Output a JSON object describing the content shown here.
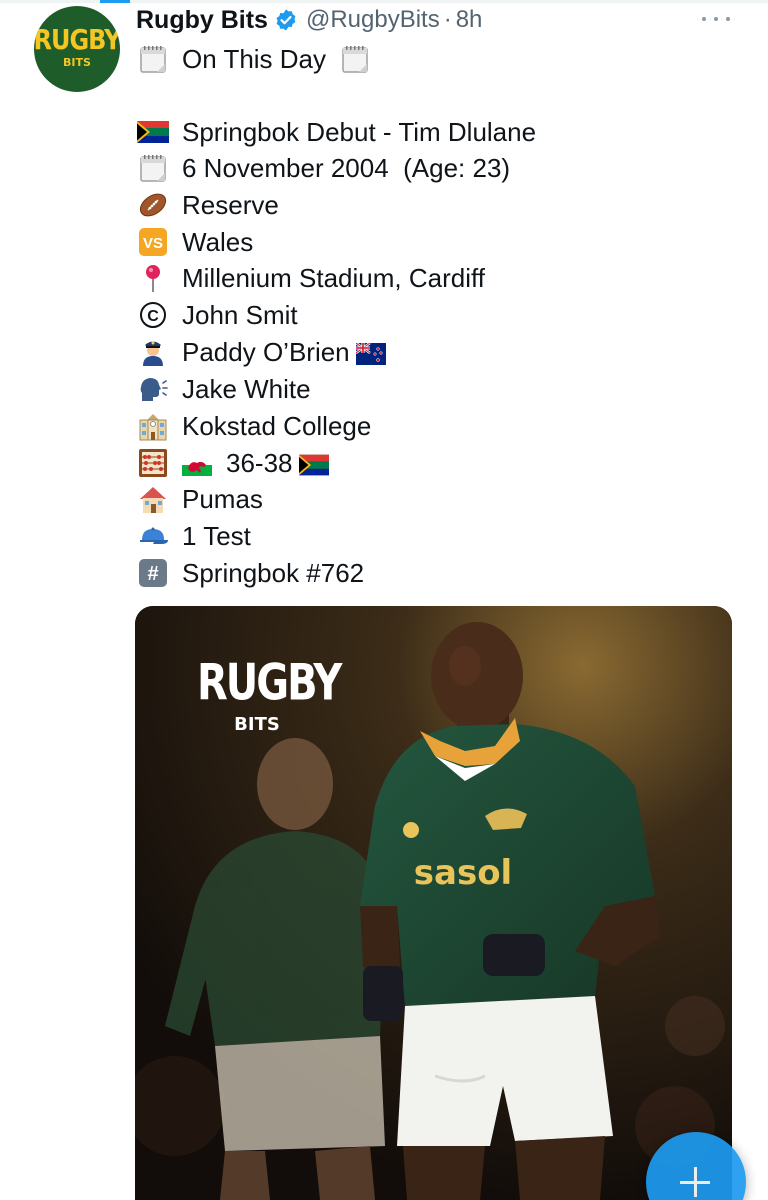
{
  "tweet": {
    "author_name": "Rugby Bits",
    "handle": "@RugbyBits",
    "separator": "·",
    "time": "8h",
    "avatar": {
      "line1": "RUGBY",
      "line2": "BITS",
      "bg_color": "#1e5c2a",
      "text_color": "#f3c623"
    },
    "heading": "On This Day",
    "lines": [
      {
        "icon": "south-africa-flag-icon",
        "text": "Springbok Debut - Tim Dlulane"
      },
      {
        "icon": "calendar-icon",
        "text": "6 November 2004  (Age: 23)"
      },
      {
        "icon": "rugby-ball-icon",
        "text": "Reserve"
      },
      {
        "icon": "vs-icon",
        "text": "Wales"
      },
      {
        "icon": "pin-icon",
        "text": "Millenium Stadium, Cardiff"
      },
      {
        "icon": "copyright-icon",
        "text": "John Smit"
      },
      {
        "icon": "police-officer-icon",
        "text": "Paddy O’Brien",
        "trailing_icon": "new-zealand-flag-icon"
      },
      {
        "icon": "speaking-head-icon",
        "text": "Jake White"
      },
      {
        "icon": "school-icon",
        "text": "Kokstad College"
      },
      {
        "icon": "abacus-icon",
        "leading_icon": "wales-flag-icon",
        "text": "36-38",
        "trailing_icon": "south-africa-flag-icon"
      },
      {
        "icon": "house-icon",
        "text": "Pumas"
      },
      {
        "icon": "cap-icon",
        "text": "1 Test"
      },
      {
        "icon": "hash-icon",
        "text": "Springbok #762"
      }
    ],
    "photo": {
      "logo_line1": "RUGBY",
      "logo_line2": "BITS",
      "jersey_sponsor": "sasol",
      "jersey_color": "#1f4a35",
      "collar_color": "#e8a23a"
    }
  },
  "colors": {
    "accent": "#1d9bf0",
    "text": "#0f1419",
    "muted": "#536471"
  }
}
